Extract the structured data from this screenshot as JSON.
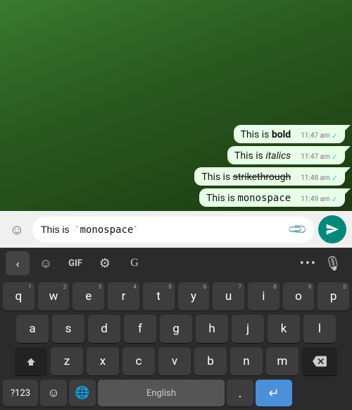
{
  "chat": {
    "messages": [
      {
        "text_prefix": "This is ",
        "text_styled": "bold",
        "style": "bold",
        "time": "11:47 am",
        "ticks": "✓"
      },
      {
        "text_prefix": "This is ",
        "text_styled": "italics",
        "style": "italic",
        "time": "11:47 am",
        "ticks": "✓"
      },
      {
        "text_prefix": "This is ",
        "text_styled": "strikethrough",
        "style": "strikethrough",
        "time": "11:48 am",
        "ticks": "✓"
      },
      {
        "text_prefix": "This is ",
        "text_styled": "monospace",
        "style": "mono",
        "time": "11:49 am",
        "ticks": "✓"
      }
    ]
  },
  "input_bar": {
    "emoji_icon": "☺",
    "input_text_prefix": "This is  ",
    "input_backtick_open": "`",
    "input_mono": "monospace",
    "input_backtick_close": "`",
    "attach_icon": "📎",
    "send_icon": "send"
  },
  "keyboard_toolbar": {
    "back_icon": "‹",
    "sticker_icon": "☺",
    "gif_label": "GIF",
    "settings_icon": "⚙",
    "translate_icon": "G",
    "dots": "•••",
    "mic_icon": "🎙"
  },
  "keyboard": {
    "row1": [
      "q",
      "w",
      "e",
      "r",
      "t",
      "y",
      "u",
      "i",
      "o",
      "p"
    ],
    "row1_nums": [
      "1",
      "2",
      "3",
      "4",
      "5",
      "6",
      "7",
      "8",
      "9",
      "0"
    ],
    "row2": [
      "a",
      "s",
      "d",
      "f",
      "g",
      "h",
      "j",
      "k",
      "l"
    ],
    "row3": [
      "z",
      "x",
      "c",
      "v",
      "b",
      "n",
      "m"
    ],
    "bottom_bar": {
      "num_label": "?123",
      "comma_label": ",",
      "english_label": "English",
      "period_label": ".",
      "enter_icon": "↵"
    }
  },
  "colors": {
    "send_btn": "#00897b",
    "enter_btn": "#4a90d9",
    "keyboard_bg": "#2b2b2b",
    "key_bg": "#3d3d3d",
    "key_special_bg": "#222222"
  }
}
